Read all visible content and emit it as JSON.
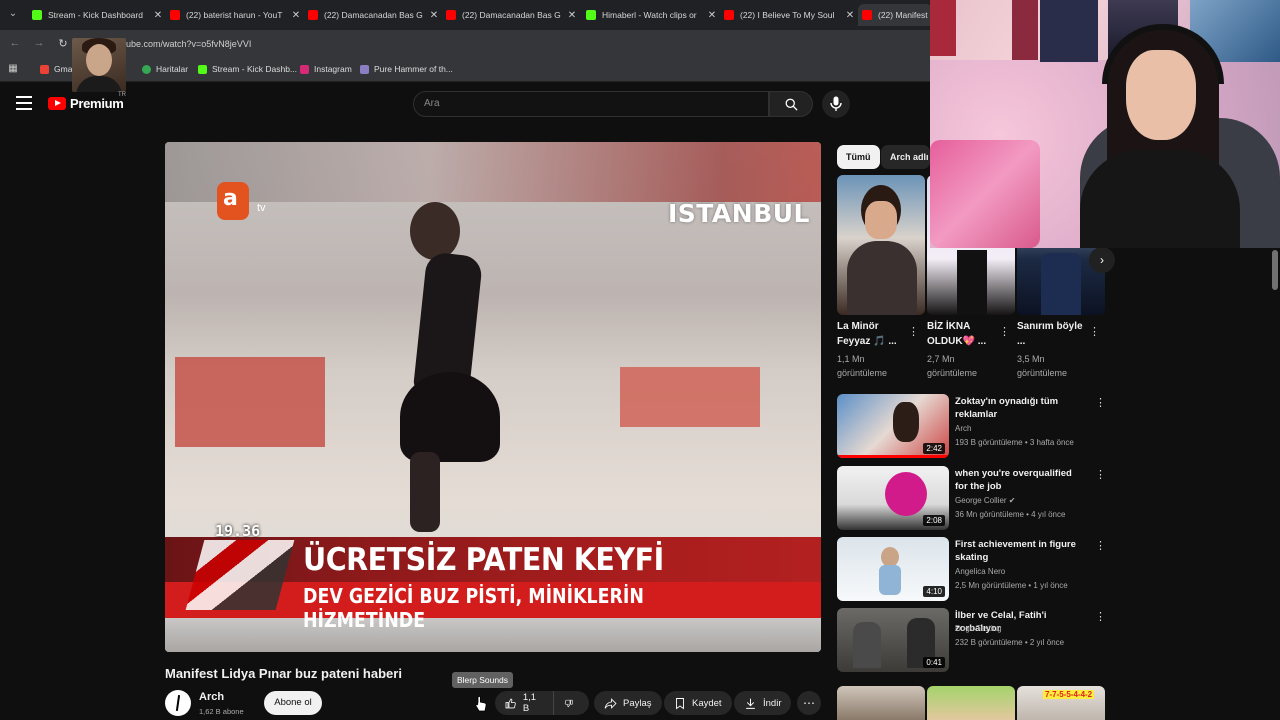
{
  "browser": {
    "tabs": [
      {
        "title": "Stream - Kick Dashboard",
        "type": "kick"
      },
      {
        "title": "(22) baterist harun - YouT",
        "type": "yt"
      },
      {
        "title": "(22) Damacanadan Bas G",
        "type": "yt"
      },
      {
        "title": "(22) Damacanadan Bas G",
        "type": "yt"
      },
      {
        "title": "Himaberl - Watch clips or",
        "type": "kick"
      },
      {
        "title": "(22) I Believe To My Soul",
        "type": "yt"
      },
      {
        "title": "(22) Manifest L",
        "type": "yt"
      }
    ],
    "url": "ube.com/watch?v=o5fvN8jeVVI",
    "bookmarks": [
      "Gmail",
      "Haritalar",
      "Stream - Kick Dashb...",
      "Instagram",
      "Pure Hammer of th..."
    ]
  },
  "header": {
    "logo": "Premium",
    "region": "TR",
    "search_placeholder": "Ara"
  },
  "video": {
    "overlay_logo": "a",
    "overlay_logo_suffix": "tv",
    "overlay_city": "ISTANBUL",
    "overlay_time": "19.36",
    "overlay_headline": "ÜCRETSİZ PATEN KEYFİ",
    "overlay_subline": "DEV GEZİCİ BUZ PİSTİ, MİNİKLERİN HİZMETİNDE",
    "title": "Manifest Lidya Pınar buz pateni haberi",
    "channel": "Arch",
    "subscribers": "1,62 B abone",
    "subscribe_label": "Abone ol",
    "tooltip": "Blerp Sounds",
    "likes": "1,1 B",
    "share_label": "Paylaş",
    "save_label": "Kaydet",
    "download_label": "İndir"
  },
  "sidebar": {
    "chips": [
      "Tümü",
      "Arch adlı"
    ],
    "shorts": [
      {
        "title": "La Minör Feyyaz 🎵 ...",
        "views": "1,1 Mn görüntüleme"
      },
      {
        "title": "BİZ İKNA OLDUK💖 ...",
        "views": "2,7 Mn görüntüleme"
      },
      {
        "title": "Sanırım böyle ...",
        "views": "3,5 Mn görüntüleme"
      }
    ],
    "recommendations": [
      {
        "title": "Zoktay'ın oynadığı tüm reklamlar",
        "channel": "Arch",
        "meta": "193 B görüntüleme • 3 hafta önce",
        "duration": "2:42"
      },
      {
        "title": "when you're overqualified for the job",
        "channel": "George Collier ✔",
        "meta": "36 Mn görüntüleme • 4 yıl önce",
        "duration": "2:08"
      },
      {
        "title": "First achievement in figure skating",
        "channel": "Angelica Nero",
        "meta": "2,5 Mn görüntüleme • 1 yıl önce",
        "duration": "4:10"
      },
      {
        "title": "İlber ve Celal, Fatih'i zorbalıyor",
        "channel": "Dogu Testing",
        "meta": "232 B görüntüleme • 2 yıl önce",
        "duration": "0:41"
      }
    ],
    "bottom_thumb_text": "7-7-5-5-4-4-2"
  },
  "colors": {
    "accent": "#ff0000",
    "background": "#0f0f0f",
    "kick": "#53fc18"
  }
}
